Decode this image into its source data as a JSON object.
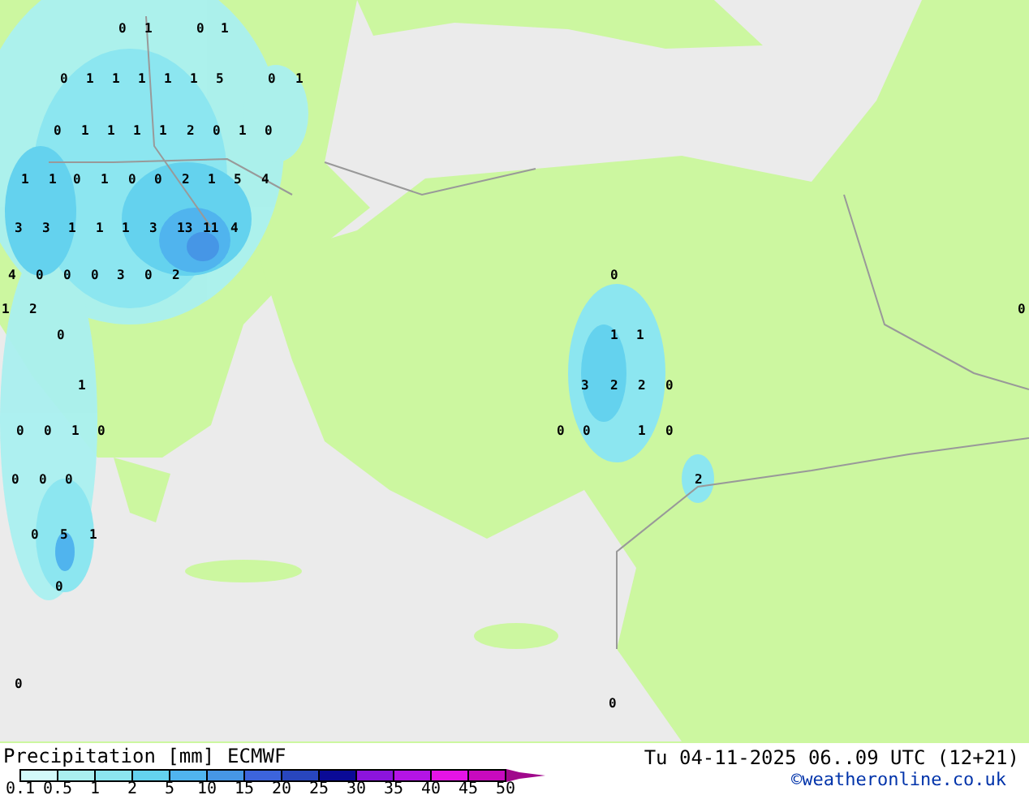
{
  "map": {
    "labels": [
      {
        "text": "0"
      },
      {
        "text": "1"
      },
      {
        "text": "0"
      },
      {
        "text": "1"
      },
      {
        "text": "0"
      },
      {
        "text": "1"
      },
      {
        "text": "1"
      },
      {
        "text": "1"
      },
      {
        "text": "1"
      },
      {
        "text": "1"
      },
      {
        "text": "5"
      },
      {
        "text": "0"
      },
      {
        "text": "1"
      },
      {
        "text": "0"
      },
      {
        "text": "1"
      },
      {
        "text": "1"
      },
      {
        "text": "1"
      },
      {
        "text": "1"
      },
      {
        "text": "2"
      },
      {
        "text": "0"
      },
      {
        "text": "1"
      },
      {
        "text": "0"
      },
      {
        "text": "1"
      },
      {
        "text": "1"
      },
      {
        "text": "0"
      },
      {
        "text": "1"
      },
      {
        "text": "0"
      },
      {
        "text": "0"
      },
      {
        "text": "2"
      },
      {
        "text": "1"
      },
      {
        "text": "5"
      },
      {
        "text": "4"
      },
      {
        "text": "3"
      },
      {
        "text": "3"
      },
      {
        "text": "1"
      },
      {
        "text": "1"
      },
      {
        "text": "1"
      },
      {
        "text": "3"
      },
      {
        "text": "13"
      },
      {
        "text": "11"
      },
      {
        "text": "4"
      },
      {
        "text": "4"
      },
      {
        "text": "0"
      },
      {
        "text": "0"
      },
      {
        "text": "0"
      },
      {
        "text": "3"
      },
      {
        "text": "0"
      },
      {
        "text": "2"
      },
      {
        "text": "0"
      },
      {
        "text": "1"
      },
      {
        "text": "2"
      },
      {
        "text": "0"
      },
      {
        "text": "0"
      },
      {
        "text": "1"
      },
      {
        "text": "1"
      },
      {
        "text": "1"
      },
      {
        "text": "3"
      },
      {
        "text": "2"
      },
      {
        "text": "2"
      },
      {
        "text": "0"
      },
      {
        "text": "0"
      },
      {
        "text": "0"
      },
      {
        "text": "1"
      },
      {
        "text": "0"
      },
      {
        "text": "0"
      },
      {
        "text": "0"
      },
      {
        "text": "1"
      },
      {
        "text": "0"
      },
      {
        "text": "0"
      },
      {
        "text": "0"
      },
      {
        "text": "0"
      },
      {
        "text": "2"
      },
      {
        "text": "0"
      },
      {
        "text": "5"
      },
      {
        "text": "1"
      },
      {
        "text": "0"
      },
      {
        "text": "0"
      },
      {
        "text": "0"
      }
    ]
  },
  "legend": {
    "title": "Precipitation [mm]",
    "model": "ECMWF",
    "bins": [
      {
        "color": "#d2fafa"
      },
      {
        "color": "#aaf0f0"
      },
      {
        "color": "#8ce6f0"
      },
      {
        "color": "#64d2ee"
      },
      {
        "color": "#50b4ee"
      },
      {
        "color": "#4696e6"
      },
      {
        "color": "#3c64dc"
      },
      {
        "color": "#2846be"
      },
      {
        "color": "#0a0a96"
      },
      {
        "color": "#8c14dc"
      },
      {
        "color": "#b414e6"
      },
      {
        "color": "#e614e6"
      },
      {
        "color": "#c80abe"
      }
    ],
    "ticks": [
      "0.1",
      "0.5",
      "1",
      "2",
      "5",
      "10",
      "15",
      "20",
      "25",
      "30",
      "35",
      "40",
      "45",
      "50"
    ]
  },
  "footer": {
    "valid_time": "Tu 04-11-2025 06..09 UTC (12+21)",
    "copyright": "©weatheronline.co.uk"
  }
}
